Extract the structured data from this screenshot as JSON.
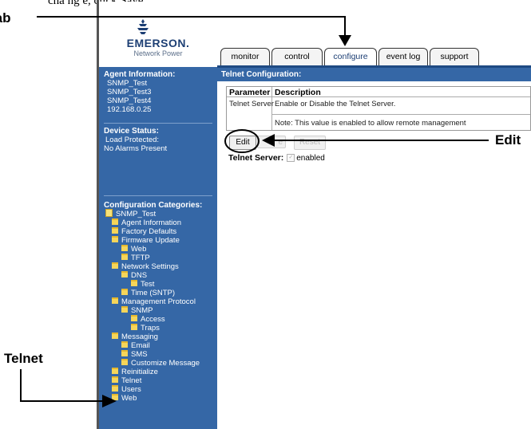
{
  "page_top_text": "cha ng e, click Save.",
  "callouts": {
    "tab": "tab",
    "edit": "Edit",
    "telnet": "Telnet"
  },
  "logo": {
    "name": "EMERSON.",
    "tagline": "Network Power"
  },
  "sidebar": {
    "agent_info_heading": "Agent Information:",
    "agent_info": [
      "SNMP_Test",
      "SNMP_Test3",
      "SNMP_Test4",
      "192.168.0.25"
    ],
    "device_status_heading": "Device Status:",
    "device_status": [
      "Load Protected:",
      "No Alarms Present"
    ],
    "config_heading": "Configuration Categories:",
    "tree": {
      "root": "SNMP_Test",
      "items": [
        {
          "label": "Agent Information"
        },
        {
          "label": "Factory Defaults"
        },
        {
          "label": "Firmware Update"
        },
        {
          "label": "Web"
        },
        {
          "label": "TFTP"
        },
        {
          "label": "Network Settings"
        },
        {
          "label": "DNS"
        },
        {
          "label": "Test"
        },
        {
          "label": "Time (SNTP)"
        },
        {
          "label": "Management Protocol"
        },
        {
          "label": "SNMP"
        },
        {
          "label": "Access"
        },
        {
          "label": "Traps"
        },
        {
          "label": "Messaging"
        },
        {
          "label": "Email"
        },
        {
          "label": "SMS"
        },
        {
          "label": "Customize Message"
        },
        {
          "label": "Reinitialize"
        },
        {
          "label": "Telnet"
        },
        {
          "label": "Users"
        },
        {
          "label": "Web"
        }
      ]
    }
  },
  "tabs": [
    {
      "label": "monitor"
    },
    {
      "label": "control"
    },
    {
      "label": "configure",
      "active": true
    },
    {
      "label": "event log"
    },
    {
      "label": "support"
    }
  ],
  "section_title": "Telnet Configuration:",
  "table": {
    "headers": [
      "Parameter",
      "Description"
    ],
    "row": {
      "parameter": "Telnet Server",
      "description": "Enable or Disable the Telnet Server.",
      "note": "Note: This value is enabled to allow remote management"
    }
  },
  "buttons": {
    "edit": "Edit",
    "save_partial": "e",
    "reset": "Reset"
  },
  "telnet_server": {
    "label": "Telnet Server:",
    "value": "enabled",
    "checked": true
  },
  "colors": {
    "sidebar_bg": "#3567a6",
    "brand_navy": "#1d3f74"
  }
}
